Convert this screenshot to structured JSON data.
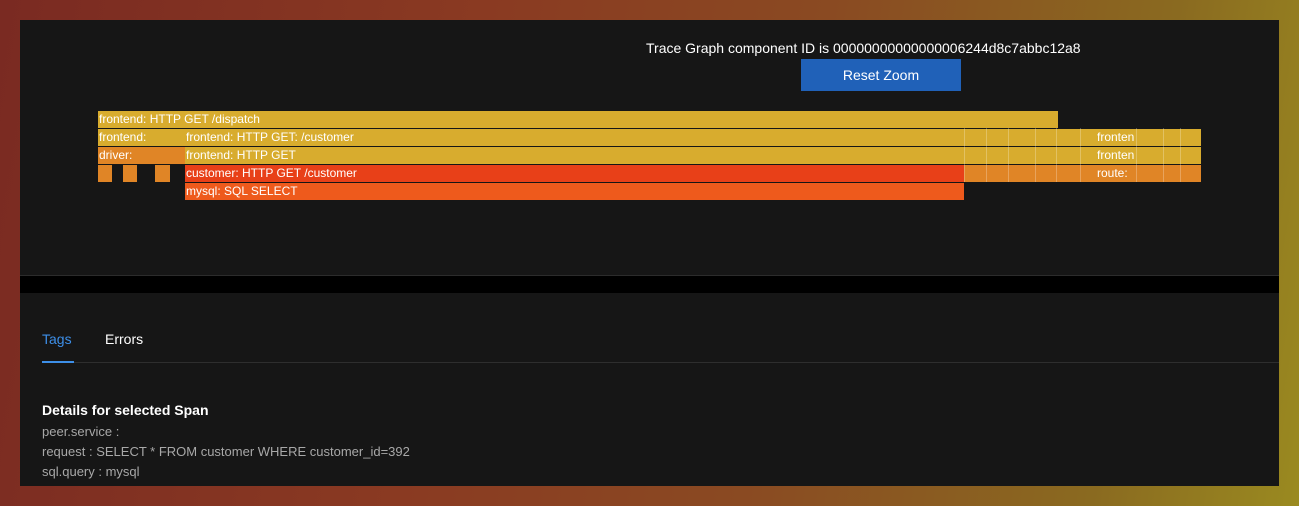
{
  "graph": {
    "title": "Trace Graph component ID is 00000000000000006244d8c7abbc12a8",
    "reset_zoom_label": "Reset Zoom",
    "spans": {
      "dispatch": "frontend: HTTP GET /dispatch",
      "frontend_row": "frontend:",
      "frontend_customer": "frontend: HTTP GET: /customer",
      "driver_row": "driver:",
      "frontend_get": "frontend: HTTP GET",
      "customer_get": "customer: HTTP GET /customer",
      "mysql_select": "mysql: SQL SELECT",
      "right_frontend_1": "fronten",
      "right_frontend_2": "fronten",
      "right_route": "route:"
    },
    "colors": {
      "frontend": "#d8ac2e",
      "driver": "#e08526",
      "customer": "#e84018",
      "mysql": "#ee5a1c",
      "accent": "#2061b8"
    }
  },
  "tabs": [
    {
      "label": "Tags",
      "active": true
    },
    {
      "label": "Errors",
      "active": false
    }
  ],
  "details": {
    "title": "Details for selected Span",
    "rows": [
      "peer.service :",
      "request : SELECT * FROM customer WHERE customer_id=392",
      "sql.query : mysql"
    ]
  }
}
